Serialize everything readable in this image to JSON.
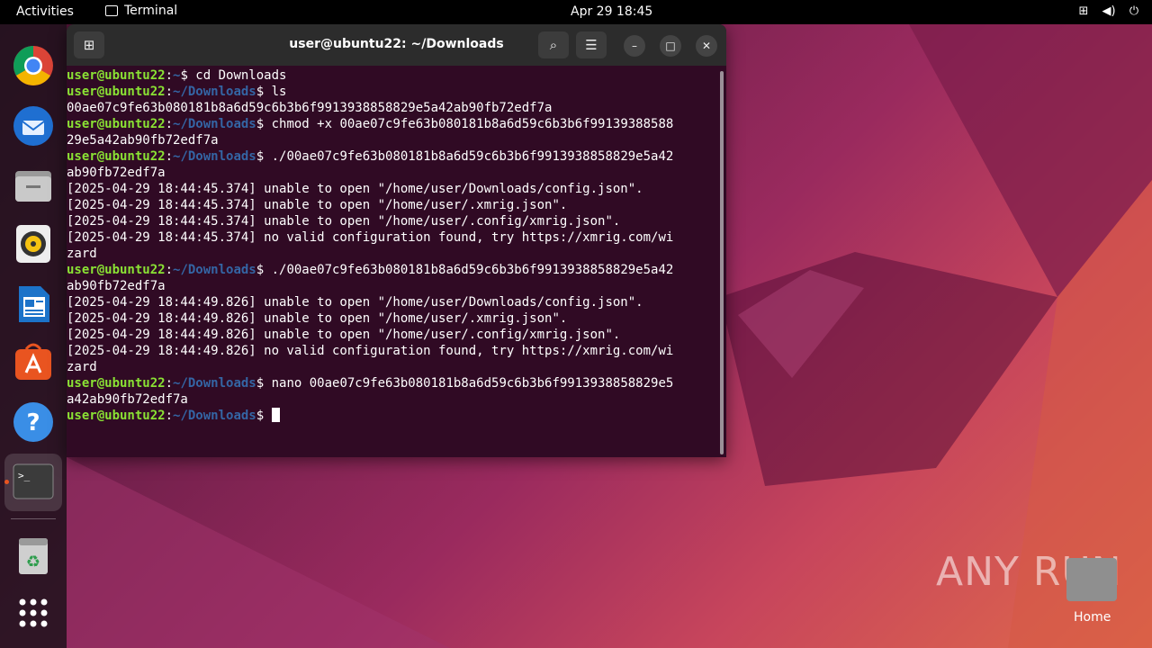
{
  "topbar": {
    "activities": "Activities",
    "app_name": "Terminal",
    "clock": "Apr 29  18:45",
    "tray_icons": [
      "network-icon",
      "volume-icon",
      "power-icon"
    ]
  },
  "dock": {
    "items": [
      "chrome-icon",
      "thunderbird-icon",
      "files-icon",
      "rhythmbox-icon",
      "writer-icon",
      "app-center-icon",
      "help-icon",
      "terminal-icon",
      "trash-icon",
      "show-apps-icon"
    ]
  },
  "terminal": {
    "title": "user@ubuntu22: ~/Downloads",
    "lines": [
      {
        "user": "user@ubuntu22",
        "sep": ":",
        "path": "~",
        "cmd": "$ cd Downloads"
      },
      {
        "user": "user@ubuntu22",
        "sep": ":",
        "path": "~/Downloads",
        "cmd": "$ ls"
      },
      {
        "text": "00ae07c9fe63b080181b8a6d59c6b3b6f9913938858829e5a42ab90fb72edf7a"
      },
      {
        "user": "user@ubuntu22",
        "sep": ":",
        "path": "~/Downloads",
        "cmd": "$ chmod +x 00ae07c9fe63b080181b8a6d59c6b3b6f99139388588"
      },
      {
        "text": "29e5a42ab90fb72edf7a"
      },
      {
        "user": "user@ubuntu22",
        "sep": ":",
        "path": "~/Downloads",
        "cmd": "$ ./00ae07c9fe63b080181b8a6d59c6b3b6f9913938858829e5a42"
      },
      {
        "text": "ab90fb72edf7a"
      },
      {
        "text": "[2025-04-29 18:44:45.374] unable to open \"/home/user/Downloads/config.json\"."
      },
      {
        "text": "[2025-04-29 18:44:45.374] unable to open \"/home/user/.xmrig.json\"."
      },
      {
        "text": "[2025-04-29 18:44:45.374] unable to open \"/home/user/.config/xmrig.json\"."
      },
      {
        "text": "[2025-04-29 18:44:45.374] no valid configuration found, try https://xmrig.com/wi"
      },
      {
        "text": "zard"
      },
      {
        "user": "user@ubuntu22",
        "sep": ":",
        "path": "~/Downloads",
        "cmd": "$ ./00ae07c9fe63b080181b8a6d59c6b3b6f9913938858829e5a42"
      },
      {
        "text": "ab90fb72edf7a"
      },
      {
        "text": "[2025-04-29 18:44:49.826] unable to open \"/home/user/Downloads/config.json\"."
      },
      {
        "text": "[2025-04-29 18:44:49.826] unable to open \"/home/user/.xmrig.json\"."
      },
      {
        "text": "[2025-04-29 18:44:49.826] unable to open \"/home/user/.config/xmrig.json\"."
      },
      {
        "text": "[2025-04-29 18:44:49.826] no valid configuration found, try https://xmrig.com/wi"
      },
      {
        "text": "zard"
      },
      {
        "user": "user@ubuntu22",
        "sep": ":",
        "path": "~/Downloads",
        "cmd": "$ nano 00ae07c9fe63b080181b8a6d59c6b3b6f9913938858829e5"
      },
      {
        "text": "a42ab90fb72edf7a"
      },
      {
        "user": "user@ubuntu22",
        "sep": ":",
        "path": "~/Downloads",
        "cmd": "$ ",
        "cursor": true
      }
    ]
  },
  "desktop": {
    "home_label": "Home",
    "watermark": "ANY RUN"
  },
  "colors": {
    "terminal_bg": "#300a24",
    "prompt_user": "#8ae234",
    "prompt_path": "#3465a4",
    "accent": "#e95420"
  }
}
